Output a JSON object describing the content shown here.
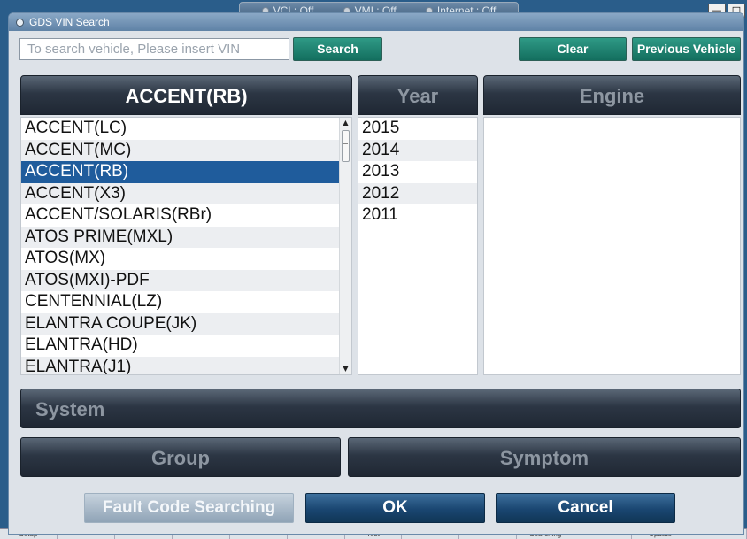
{
  "background": {
    "status": [
      {
        "label": "VCI : Off"
      },
      {
        "label": "VMI : Off"
      },
      {
        "label": "Internet : Off"
      }
    ],
    "window_buttons": [
      "—",
      "□"
    ],
    "bottom_tabs": [
      "Setup",
      "",
      "",
      "",
      "",
      "",
      "Test",
      "",
      "",
      "Searching",
      "",
      "Update",
      ""
    ]
  },
  "dialog": {
    "title": "GDS VIN Search"
  },
  "search": {
    "placeholder": "To search vehicle, Please insert VIN",
    "value": "",
    "search_label": "Search",
    "clear_label": "Clear",
    "previous_label": "Previous Vehicle"
  },
  "model_panel": {
    "header": "ACCENT(RB)",
    "items": [
      "ACCENT(LC)",
      "ACCENT(MC)",
      "ACCENT(RB)",
      "ACCENT(X3)",
      "ACCENT/SOLARIS(RBr)",
      "ATOS PRIME(MXL)",
      "ATOS(MX)",
      "ATOS(MXI)-PDF",
      "CENTENNIAL(LZ)",
      "ELANTRA COUPE(JK)",
      "ELANTRA(HD)",
      "ELANTRA(J1)"
    ],
    "selected_index": 2
  },
  "year_panel": {
    "header": "Year",
    "items": [
      "2015",
      "2014",
      "2013",
      "2012",
      "2011"
    ]
  },
  "engine_panel": {
    "header": "Engine",
    "items": []
  },
  "system": {
    "label": "System"
  },
  "group": {
    "label": "Group"
  },
  "symptom": {
    "label": "Symptom"
  },
  "buttons": {
    "fault_code": "Fault Code Searching",
    "ok": "OK",
    "cancel": "Cancel"
  },
  "colors": {
    "selected_row": "#1f5c9c",
    "teal_button": "#1f8a76",
    "navy_button": "#1a4671"
  }
}
